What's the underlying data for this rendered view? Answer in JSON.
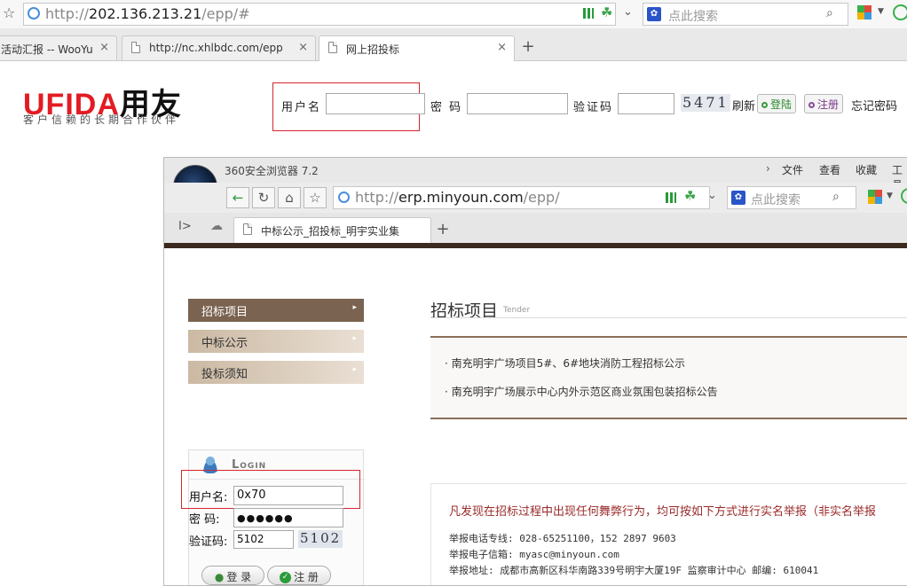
{
  "outer": {
    "url_host": "202.136.213.21",
    "url_prefix": "http://",
    "url_path": "/epp/#",
    "search_placeholder": "点此搜索",
    "tabs": [
      {
        "label": "活动汇报 -- WooYu"
      },
      {
        "label": "http://nc.xhlbdc.com/epp/h"
      },
      {
        "label": "网上招投标"
      }
    ],
    "new_tab": "+",
    "close": "×"
  },
  "header": {
    "logo_latin": "UFIDA",
    "logo_cn": "用友",
    "slogan": "客户信赖的长期合作伙伴",
    "username_label": "用户名",
    "password_label": "密 码",
    "captcha_label": "验证码",
    "captcha_image": "5471",
    "refresh": "刷新",
    "login": "登陆",
    "register": "注册",
    "forgot": "忘记密码"
  },
  "inner": {
    "browser_title": "360安全浏览器 7.2",
    "menu": [
      "文件",
      "查看",
      "收藏",
      "工具"
    ],
    "url_prefix": "http://",
    "url_host": "erp.minyoun.com",
    "url_path": "/epp/",
    "search_placeholder": "点此搜索",
    "tab_label": "中标公示_招投标_明宇实业集",
    "new_tab": "+",
    "sidebar": [
      {
        "label": "招标项目"
      },
      {
        "label": "中标公示"
      },
      {
        "label": "投标须知"
      }
    ],
    "section_title": "招标项目",
    "section_sub": "Tender",
    "news": [
      {
        "text": "· 南充明宇广场项目5#、6#地块消防工程招标公示"
      },
      {
        "text": "· 南充明宇广场展示中心内外示范区商业氛围包装招标公告"
      }
    ],
    "login": {
      "title": "Login",
      "username_label": "用户名:",
      "username_value": "0x70",
      "password_label": "密  码:",
      "password_value": "●●●●●●",
      "captcha_label": "验证码:",
      "captcha_value": "5102",
      "captcha_image": "5102",
      "login_btn": "登 录",
      "register_btn": "注 册"
    },
    "report": {
      "heading": "凡发现在招标过程中出现任何舞弊行为，均可按如下方式进行实名举报（非实名举报",
      "phone": "举报电话专线:  028-65251100，152 2897 9603",
      "email": "举报电子信箱: myasc@minyoun.com",
      "address": "举报地址: 成都市高新区科华南路339号明宇大厦19F 监察审计中心    邮编: 610041"
    }
  }
}
